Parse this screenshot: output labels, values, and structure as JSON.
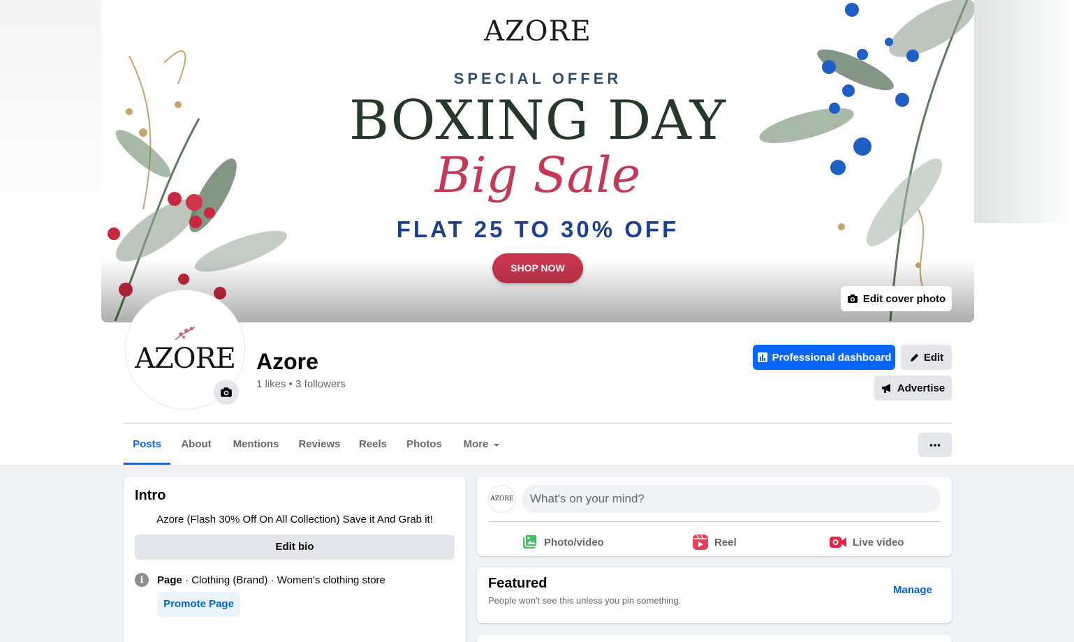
{
  "cover": {
    "brand": "AZORE",
    "special_offer": "SPECIAL OFFER",
    "headline": "BOXING DAY",
    "subheadline": "Big Sale",
    "offer": "FLAT 25 TO 30% OFF",
    "cta": "SHOP NOW",
    "edit_label": "Edit cover photo"
  },
  "profile": {
    "avatar_logo": "AZORE",
    "name": "Azore",
    "stats": "1 likes • 3 followers"
  },
  "actions": {
    "dashboard": "Professional dashboard",
    "edit": "Edit",
    "advertise": "Advertise"
  },
  "tabs": [
    "Posts",
    "About",
    "Mentions",
    "Reviews",
    "Reels",
    "Photos",
    "More"
  ],
  "intro": {
    "title": "Intro",
    "bio": "Azore (Flash 30% Off On All Collection) Save it And Grab it!",
    "edit_bio": "Edit bio",
    "category_prefix": "Page",
    "category": " · Clothing (Brand) · Women's clothing store",
    "promote": "Promote Page"
  },
  "composer": {
    "avatar": "AZORE",
    "placeholder": "What's on your mind?",
    "photo_video": "Photo/video",
    "reel": "Reel",
    "live_video": "Live video"
  },
  "featured": {
    "title": "Featured",
    "subtitle": "People won't see this unless you pin something.",
    "manage": "Manage"
  },
  "colors": {
    "accent": "#0866ff",
    "link": "#0064d1",
    "background": "#f0f2f5"
  }
}
